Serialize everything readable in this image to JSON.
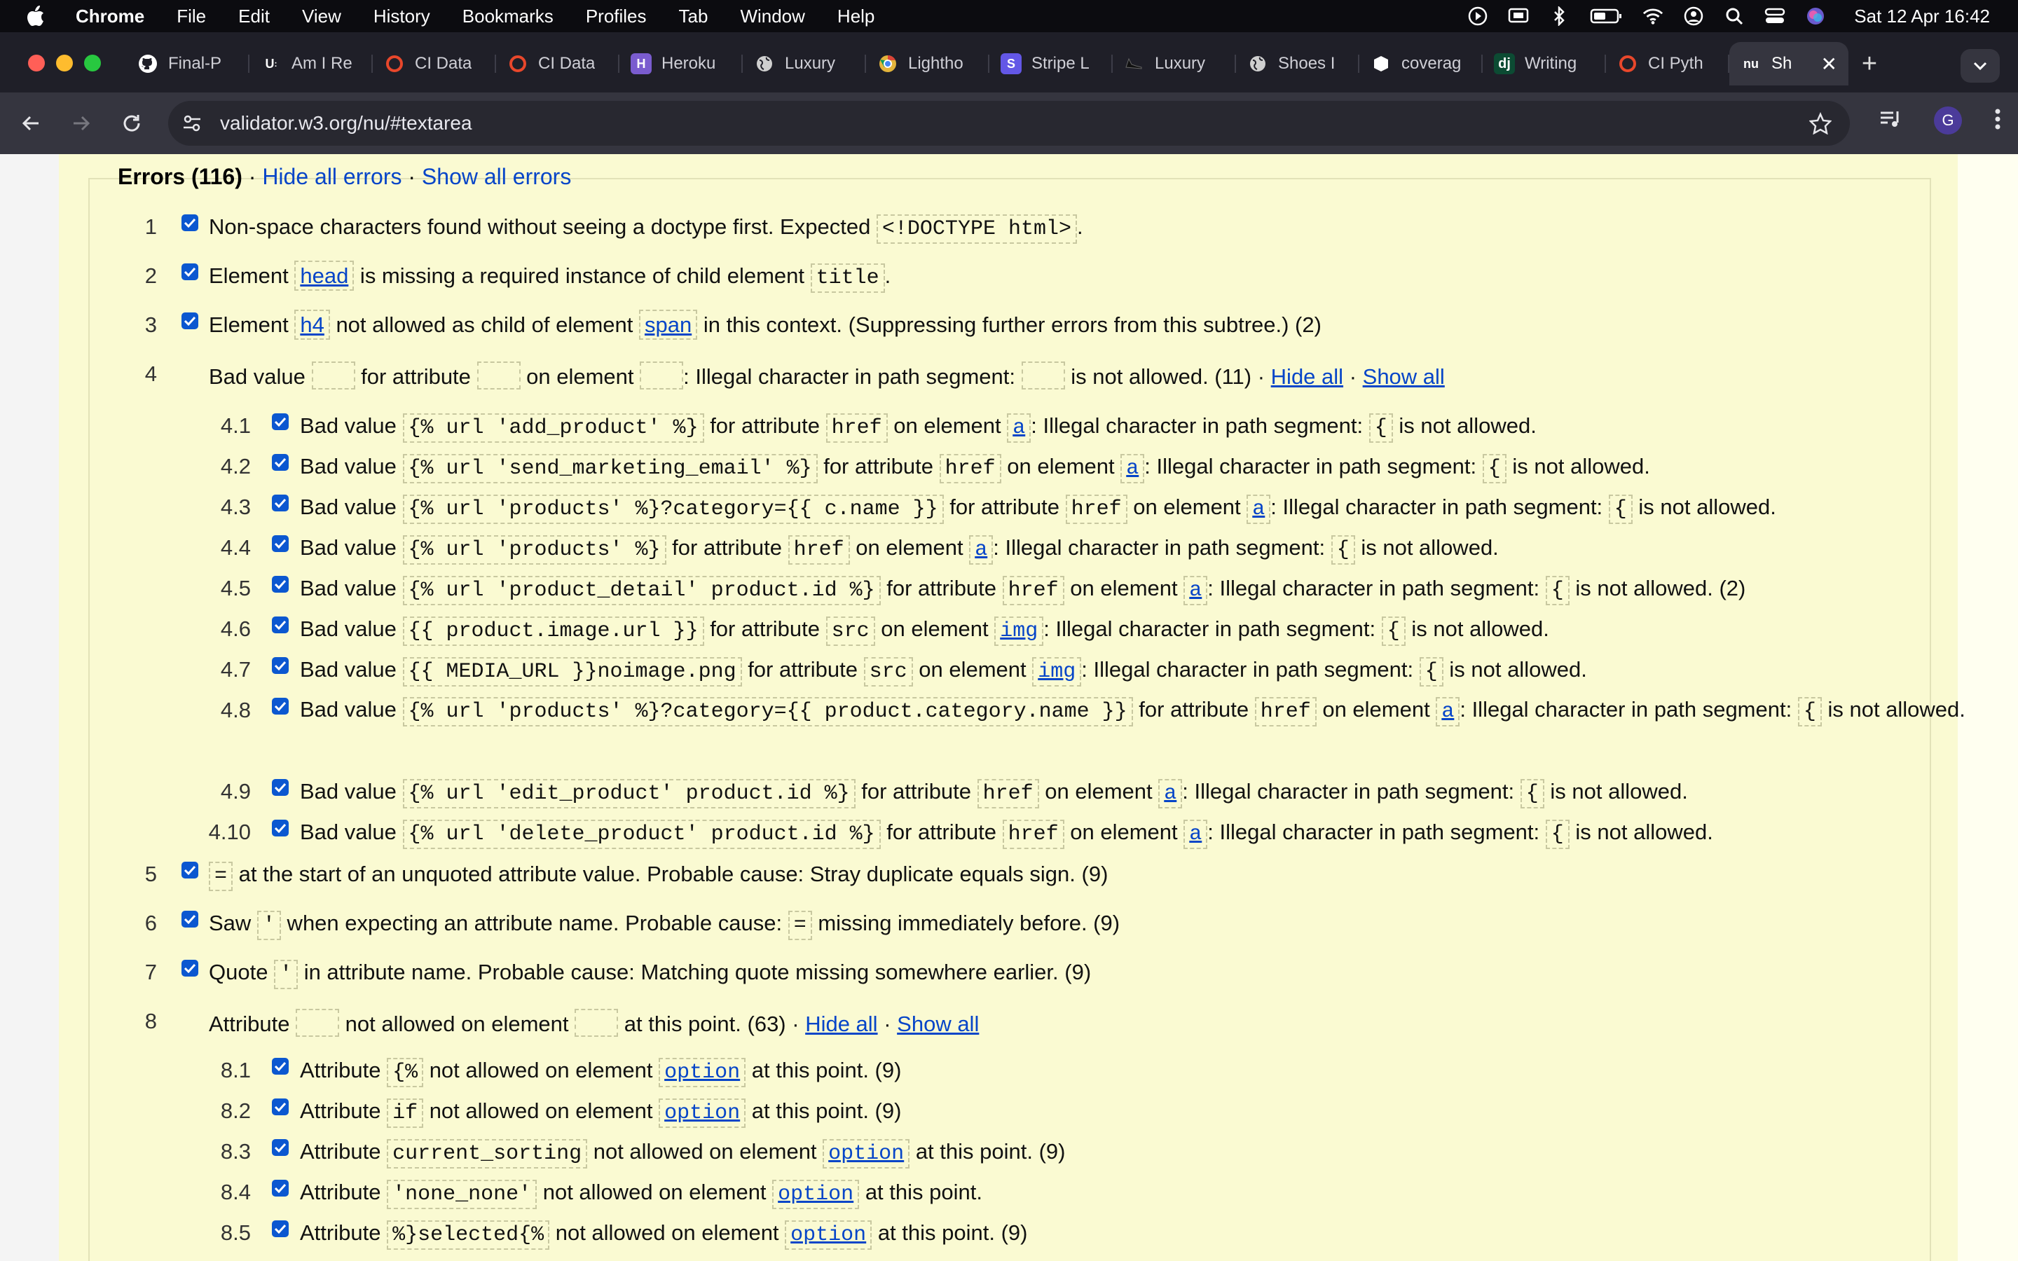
{
  "menubar": {
    "app": "Chrome",
    "items": [
      "File",
      "Edit",
      "View",
      "History",
      "Bookmarks",
      "Profiles",
      "Tab",
      "Window",
      "Help"
    ],
    "clock": "Sat 12 Apr  16:42"
  },
  "tabs": [
    {
      "label": "Final-P",
      "icon": "github-icon",
      "color": "#ffffff"
    },
    {
      "label": "Am I Re",
      "icon": "u-icon",
      "color": "#ffffff"
    },
    {
      "label": "CI Data",
      "icon": "ci-icon",
      "color": "#e8472b"
    },
    {
      "label": "CI Data",
      "icon": "ci-icon",
      "color": "#e8472b"
    },
    {
      "label": "Heroku",
      "icon": "heroku-icon",
      "color": "#7a5ccf"
    },
    {
      "label": "Luxury",
      "icon": "globe-icon",
      "color": "#cccccc"
    },
    {
      "label": "Lightho",
      "icon": "chrome-icon",
      "color": "#e3b43b"
    },
    {
      "label": "Stripe L",
      "icon": "stripe-icon",
      "color": "#6357e6"
    },
    {
      "label": "Luxury",
      "icon": "shoe-icon",
      "color": "#cccccc"
    },
    {
      "label": "Shoes I",
      "icon": "globe-icon",
      "color": "#cccccc"
    },
    {
      "label": "coverag",
      "icon": "shield-icon",
      "color": "#ffffff"
    },
    {
      "label": "Writing",
      "icon": "django-icon",
      "color": "#0c4b33"
    },
    {
      "label": "CI Pyth",
      "icon": "ci-icon",
      "color": "#e8472b"
    },
    {
      "label": "Sh",
      "icon": "nu-icon",
      "color": "#ffffff",
      "active": true
    }
  ],
  "toolbar": {
    "url": "validator.w3.org/nu/#textarea",
    "avatar_letter": "G"
  },
  "errors": {
    "title": "Errors (116)",
    "hide_all": "Hide all errors",
    "show_all": "Show all errors",
    "sep": "·",
    "group_hide": "Hide all",
    "group_show": "Show all",
    "items": {
      "e1": {
        "num": "1",
        "t1": "Non-space characters found without seeing a doctype first. Expected ",
        "c1": "<!DOCTYPE html>",
        "t2": "."
      },
      "e2": {
        "num": "2",
        "t1": "Element ",
        "l1": "head",
        "t2": " is missing a required instance of child element ",
        "c1": "title",
        "t3": "."
      },
      "e3": {
        "num": "3",
        "t1": "Element ",
        "l1": "h4",
        "t2": " not allowed as child of element ",
        "l2": "span",
        "t3": " in this context. (Suppressing further errors from this subtree.) (2)"
      },
      "e4": {
        "num": "4",
        "t1": "Bad value ",
        "t2": " for attribute ",
        "t3": " on element ",
        "t4": ": Illegal character in path segment: ",
        "t5": " is not allowed. (11) · "
      },
      "e5": {
        "num": "5",
        "c1": "=",
        "t1": " at the start of an unquoted attribute value. Probable cause: Stray duplicate equals sign. (9)"
      },
      "e6": {
        "num": "6",
        "t1": "Saw ",
        "c1": "'",
        "t2": " when expecting an attribute name. Probable cause: ",
        "c2": "=",
        "t3": " missing immediately before. (9)"
      },
      "e7": {
        "num": "7",
        "t1": "Quote ",
        "c1": "'",
        "t2": " in attribute name. Probable cause: Matching quote missing somewhere earlier. (9)"
      },
      "e8": {
        "num": "8",
        "t1": "Attribute ",
        "t2": " not allowed on element ",
        "t3": " at this point. (63) · "
      }
    },
    "sub4": [
      {
        "num": "4.1",
        "val": "{% url 'add_product' %}",
        "attr": "href",
        "el": "a",
        "tail": " is not allowed."
      },
      {
        "num": "4.2",
        "val": "{% url 'send_marketing_email' %}",
        "attr": "href",
        "el": "a",
        "tail": " is not allowed."
      },
      {
        "num": "4.3",
        "val": "{% url 'products' %}?category={{ c.name }}",
        "attr": "href",
        "el": "a",
        "tail": " is not allowed."
      },
      {
        "num": "4.4",
        "val": "{% url 'products' %}",
        "attr": "href",
        "el": "a",
        "tail": " is not allowed."
      },
      {
        "num": "4.5",
        "val": "{% url 'product_detail' product.id %}",
        "attr": "href",
        "el": "a",
        "tail": " is not allowed. (2)"
      },
      {
        "num": "4.6",
        "val": "{{ product.image.url }}",
        "attr": "src",
        "el": "img",
        "tail": " is not allowed."
      },
      {
        "num": "4.7",
        "val": "{{ MEDIA_URL }}noimage.png",
        "attr": "src",
        "el": "img",
        "tail": " is not allowed."
      },
      {
        "num": "4.8",
        "val": "{% url 'products' %}?category={{ product.category.name }}",
        "attr": "href",
        "el": "a",
        "tail": " is not allowed."
      },
      {
        "num": "4.9",
        "val": "{% url 'edit_product' product.id %}",
        "attr": "href",
        "el": "a",
        "tail": " is not allowed."
      },
      {
        "num": "4.10",
        "val": "{% url 'delete_product' product.id %}",
        "attr": "href",
        "el": "a",
        "tail": " is not allowed."
      }
    ],
    "sub4_text": {
      "bad": "Bad value ",
      "forattr": " for attribute ",
      "onel": " on element ",
      "illegal": ": Illegal character in path segment: ",
      "brace": "{"
    },
    "sub8": [
      {
        "num": "8.1",
        "attr": "{%",
        "el": "option",
        "tail": " at this point. (9)"
      },
      {
        "num": "8.2",
        "attr": "if",
        "el": "option",
        "tail": " at this point. (9)"
      },
      {
        "num": "8.3",
        "attr": "current_sorting",
        "el": "option",
        "tail": " at this point. (9)"
      },
      {
        "num": "8.4",
        "attr": "'none_none'",
        "el": "option",
        "tail": " at this point."
      },
      {
        "num": "8.5",
        "attr": "%}selected{%",
        "el": "option",
        "tail": " at this point. (9)"
      }
    ],
    "sub8_text": {
      "attribute": "Attribute ",
      "notallowed": " not allowed on element "
    }
  },
  "colors": {
    "accent": "#0b57d0",
    "link": "#0645c8",
    "page_bg": "#fafad2"
  }
}
